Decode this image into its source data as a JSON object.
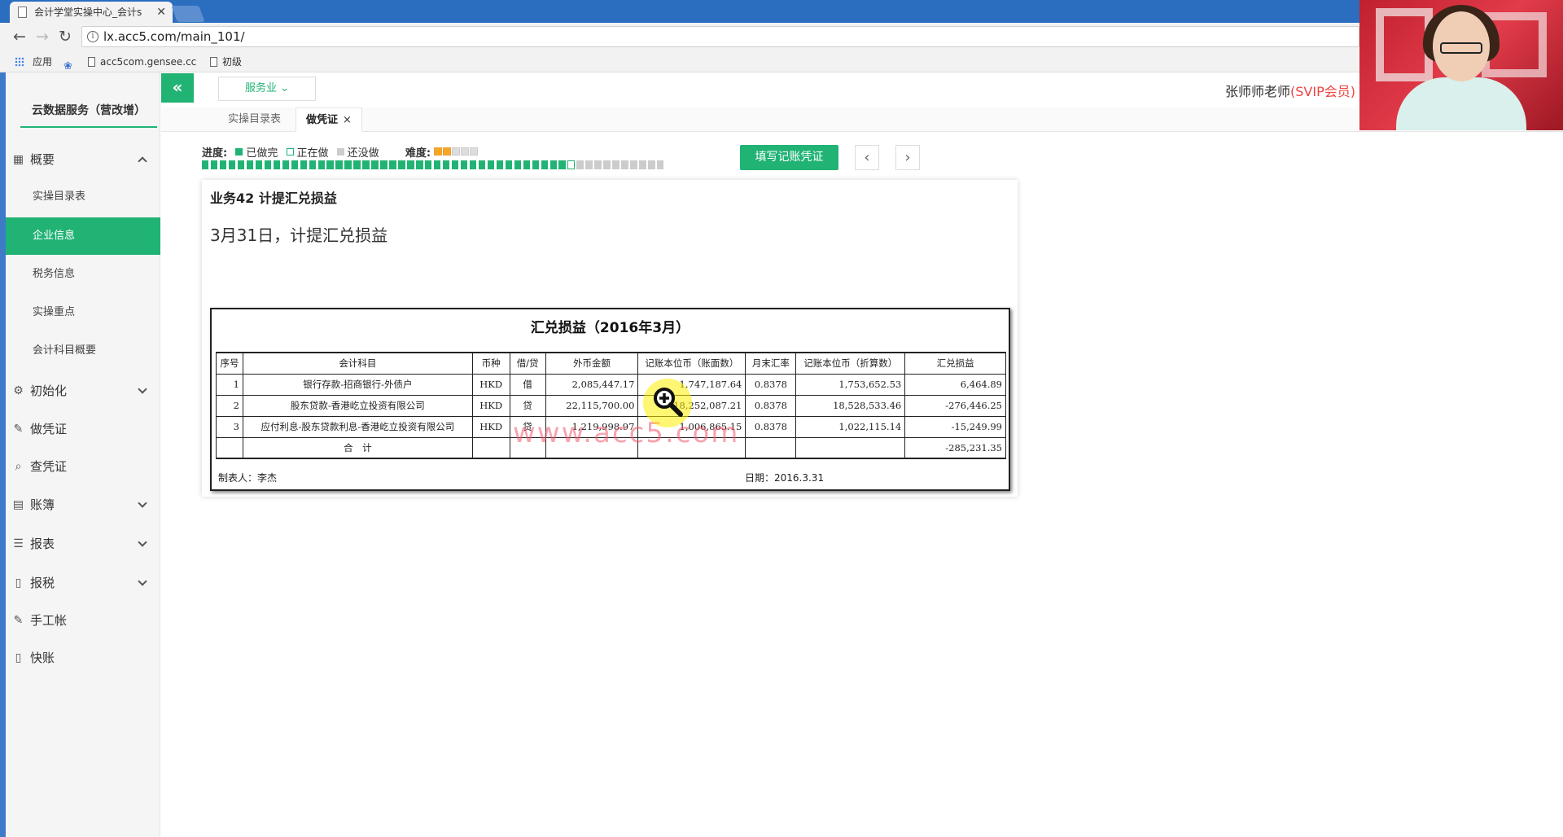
{
  "browser": {
    "tab_title": "会计学堂实操中心_会计s",
    "url": "lx.acc5.com/main_101/",
    "bookmarks": [
      "应用",
      "acc5com.gensee.cc",
      "初级"
    ]
  },
  "sidebar": {
    "brand": "云数据服务（营改增）",
    "overview": "概要",
    "sub_items": [
      "实操目录表",
      "企业信息",
      "税务信息",
      "实操重点",
      "会计科目概要"
    ],
    "items": [
      "初始化",
      "做凭证",
      "查凭证",
      "账簿",
      "报表",
      "报税",
      "手工帐",
      "快账"
    ]
  },
  "header": {
    "industry": "服务业",
    "user": "张师师老师",
    "vip": "(SVIP会员)"
  },
  "tabs": [
    "实操目录表",
    "做凭证"
  ],
  "progress": {
    "label": "进度:",
    "done": "已做完",
    "doing": "正在做",
    "todo": "还没做",
    "difficulty_label": "难度:",
    "difficulty_level": 2,
    "difficulty_max": 5,
    "current": 42,
    "total": 52,
    "colors": {
      "done": "#21b374",
      "current": "#21b374",
      "todo": "#cccccc"
    }
  },
  "actions": {
    "fill_voucher": "填写记账凭证",
    "prev": "‹",
    "next": "›"
  },
  "task": {
    "title": "业务42 计提汇兑损益",
    "description": "3月31日，计提汇兑损益"
  },
  "document": {
    "title": "汇兑损益（2016年3月）",
    "headers": [
      "序号",
      "会计科目",
      "币种",
      "借/贷",
      "外币金额",
      "记账本位币（账面数）",
      "月末汇率",
      "记账本位币（折算数）",
      "汇兑损益"
    ],
    "rows": [
      [
        "1",
        "银行存款-招商银行-外债户",
        "HKD",
        "借",
        "2,085,447.17",
        "1,747,187.64",
        "0.8378",
        "1,753,652.53",
        "6,464.89"
      ],
      [
        "2",
        "股东贷款-香港屹立投资有限公司",
        "HKD",
        "贷",
        "22,115,700.00",
        "18,252,087.21",
        "0.8378",
        "18,528,533.46",
        "-276,446.25"
      ],
      [
        "3",
        "应付利息-股东贷款利息-香港屹立投资有限公司",
        "HKD",
        "贷",
        "1,219,998.97",
        "1,006,865.15",
        "0.8378",
        "1,022,115.14",
        "-15,249.99"
      ],
      [
        "",
        "合　计",
        "",
        "",
        "",
        "",
        "",
        "",
        "-285,231.35"
      ]
    ],
    "maker": "制表人：李杰",
    "date": "日期：2016.3.31",
    "watermark": "www.acc5.com"
  },
  "colors": {
    "accent": "#21b374",
    "vip": "#ee4444",
    "browser": "#2b6dbf"
  }
}
